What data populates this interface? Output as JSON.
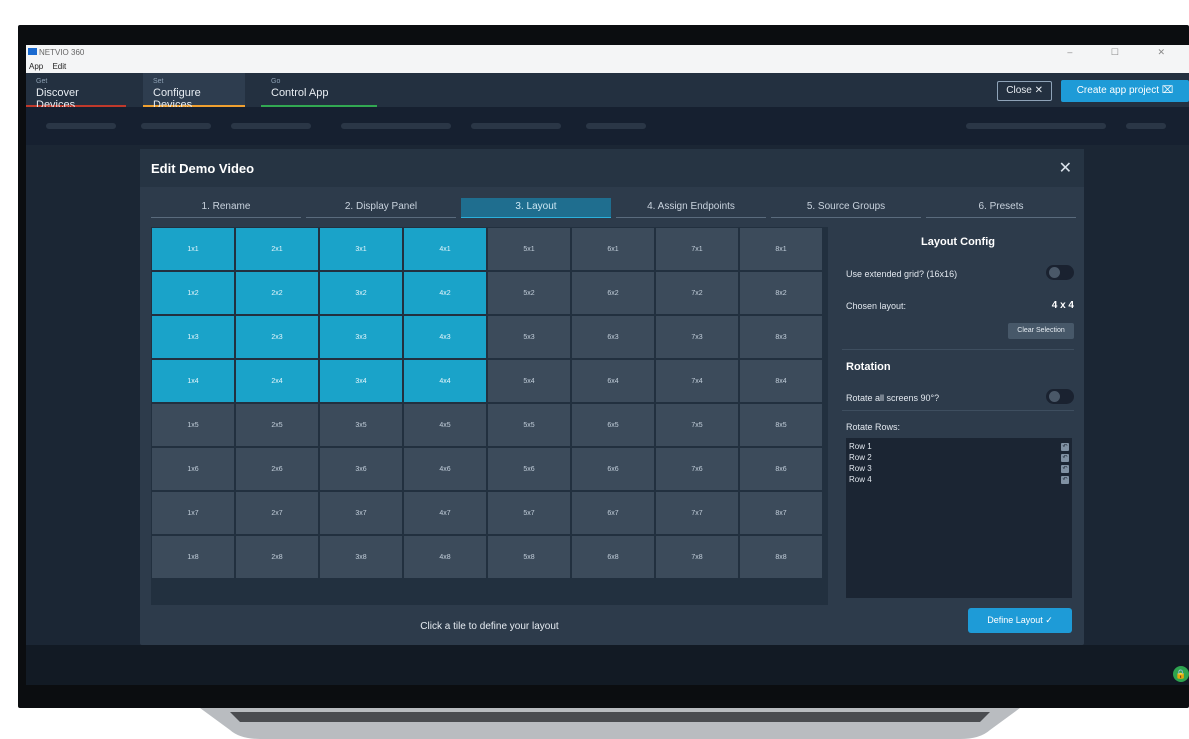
{
  "window": {
    "title": "NETVIO 360",
    "controls": "–  ☐  ✕"
  },
  "menu": {
    "items": [
      "App",
      "Edit"
    ]
  },
  "nav": {
    "discover": {
      "small": "Get",
      "label": "Discover Devices"
    },
    "configure": {
      "small": "Set",
      "label": "Configure Devices"
    },
    "control": {
      "small": "Go",
      "label": "Control App"
    },
    "close_label": "Close ✕",
    "create_label": "Create app project ⌧"
  },
  "modal": {
    "title": "Edit Demo Video",
    "close_icon": "✕",
    "steps": [
      "1. Rename",
      "2. Display Panel",
      "3. Layout",
      "4. Assign Endpoints",
      "5. Source Groups",
      "6. Presets"
    ],
    "active_step": 2,
    "grid": {
      "columns": 8,
      "rows": 8,
      "selected_cols": 4,
      "selected_rows": 4
    },
    "hint": "Click a tile to define your layout"
  },
  "config": {
    "title": "Layout Config",
    "extended_label": "Use extended grid? (16x16)",
    "chosen_label": "Chosen layout:",
    "chosen_value": "4 x 4",
    "clear_label": "Clear Selection",
    "rotation_title": "Rotation",
    "rotate_all_label": "Rotate all screens 90°?",
    "rotate_rows_label": "Rotate Rows:",
    "rotate_rows": [
      "Row 1",
      "Row 2",
      "Row 3",
      "Row 4"
    ],
    "define_label": "Define Layout ✓"
  },
  "colors": {
    "accent": "#1e9bd7",
    "tile_selected": "#1aa3c9",
    "tile_default": "#3c4b5b"
  }
}
